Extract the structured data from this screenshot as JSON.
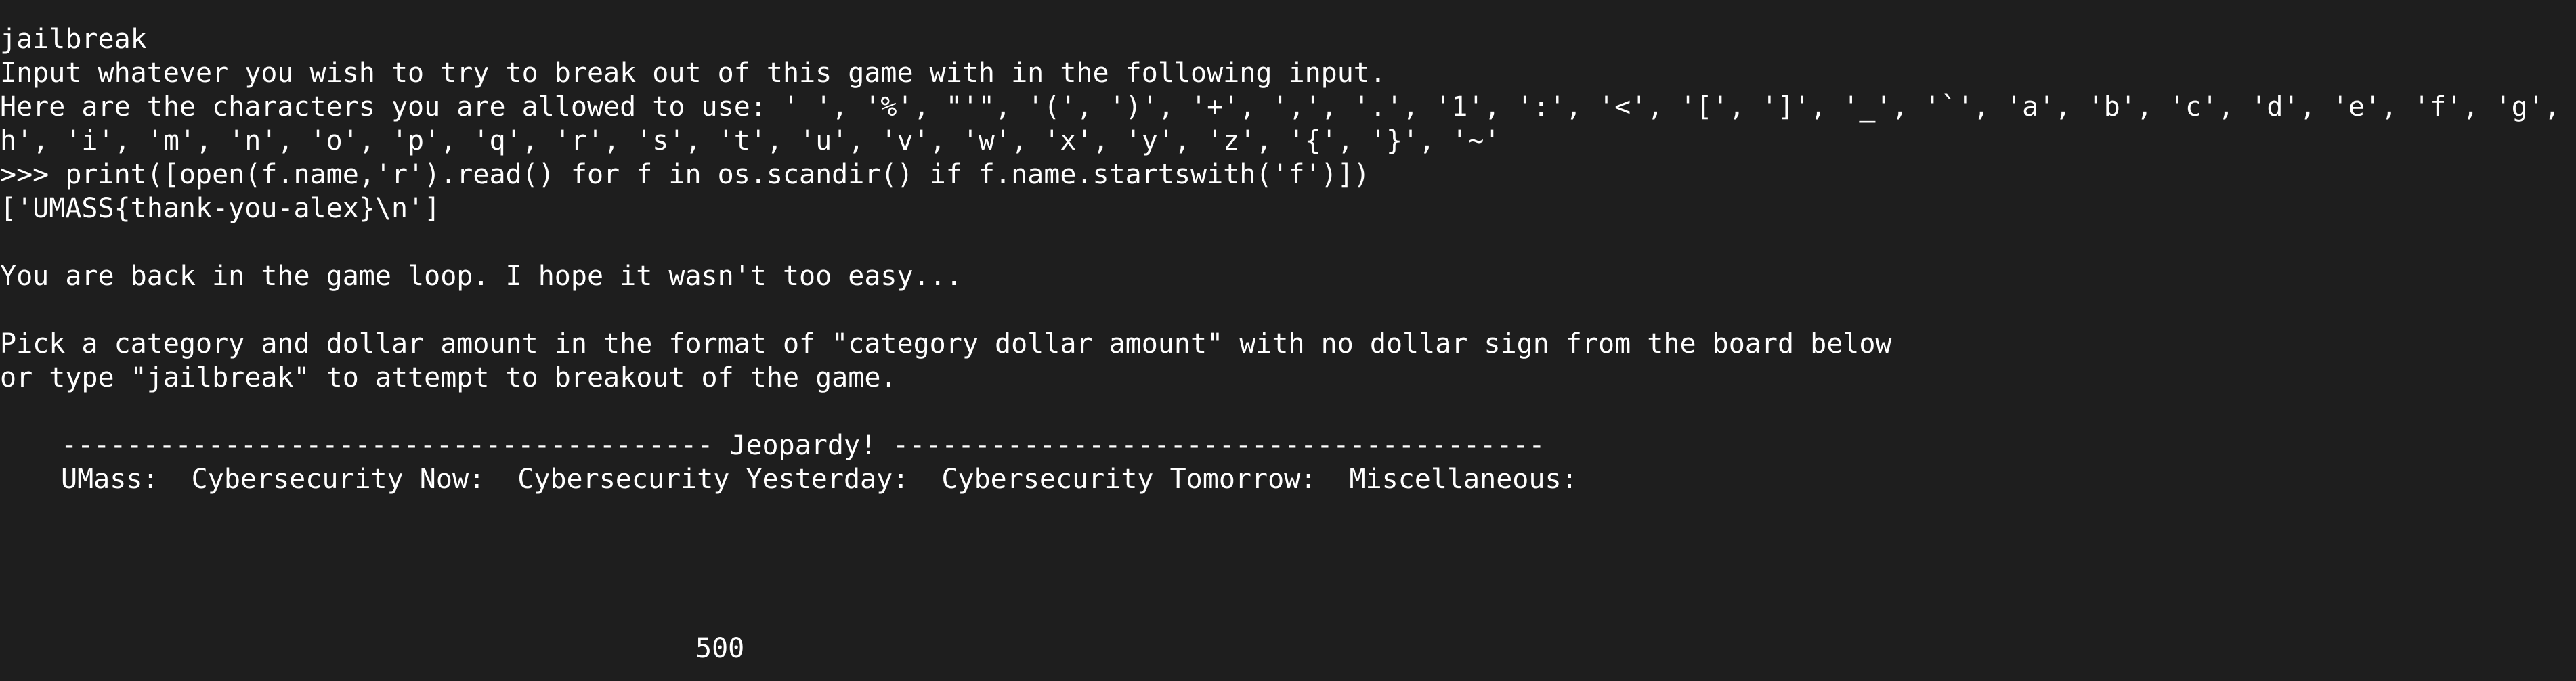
{
  "terminal": {
    "lines": {
      "command_echo": "jailbreak",
      "prompt_input": "Input whatever you wish to try to break out of this game with in the following input.",
      "allowed_chars_1": "Here are the characters you are allowed to use: ' ', '%', \"'\", '(', ')', '+', ',', '.', '1', ':', '<', '[', ']', '_', '`', 'a', 'b', 'c', 'd', 'e', 'f', 'g', '",
      "allowed_chars_2": "h', 'i', 'm', 'n', 'o', 'p', 'q', 'r', 's', 't', 'u', 'v', 'w', 'x', 'y', 'z', '{', '}', '~'",
      "python_command": ">>> print([open(f.name,'r').read() for f in os.scandir() if f.name.startswith('f')])",
      "python_output": "['UMASS{thank-you-alex}\\n']",
      "back_in_loop": "You are back in the game loop. I hope it wasn't too easy...",
      "instructions_1": "Pick a category and dollar amount in the format of \"category dollar amount\" with no dollar sign from the board below",
      "instructions_2": "or type \"jailbreak\" to attempt to breakout of the game."
    },
    "board": {
      "header": "---------------------------------------- Jeopardy! ----------------------------------------",
      "categories": "UMass:  Cybersecurity Now:  Cybersecurity Yesterday:  Cybersecurity Tomorrow:  Miscellaneous:",
      "value_visible": "500"
    }
  },
  "colors": {
    "background": "#1e1e1e",
    "text": "#ffffff"
  }
}
